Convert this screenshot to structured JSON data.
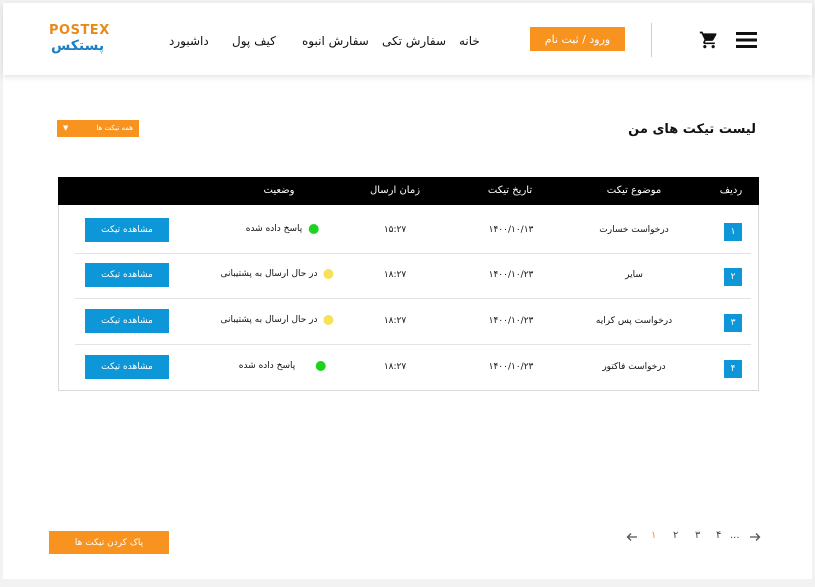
{
  "brand": {
    "logo_en": "POSTEX",
    "logo_fa": "پستکس",
    "accent": "#f7931e",
    "blue": "#0d96d8"
  },
  "nav": {
    "home": "خانه",
    "single_order": "سفارش تکی",
    "bulk_order": "سفارش انبوه",
    "wallet": "کیف پول",
    "dashboard": "داشبورد",
    "login": "ورود / ثبت نام",
    "cart_icon": "cart-icon",
    "menu_icon": "hamburger-menu-icon"
  },
  "page": {
    "title": "لیست تیکت های من"
  },
  "filter": {
    "selected": "همه تیکت ها",
    "icon": "chevron-down-icon"
  },
  "table": {
    "headers": {
      "index": "ردیف",
      "subject": "موضوع تیکت",
      "date": "تاریخ تیکت",
      "time": "زمان ارسال",
      "status": "وضعیت"
    },
    "rows": [
      {
        "index": "۱",
        "subject": "درخواست خسارت",
        "date": "۱۴۰۰/۱۰/۱۳",
        "time": "۱۵:۲۷",
        "status": "پاسخ داده شده",
        "status_color": "#1fd21f",
        "action": "مشاهده تیکت"
      },
      {
        "index": "۲",
        "subject": "سایر",
        "date": "۱۴۰۰/۱۰/۲۳",
        "time": "۱۸:۲۷",
        "status": "در حال ارسال به پشتیبانی",
        "status_color": "#f7e05a",
        "action": "مشاهده تیکت"
      },
      {
        "index": "۳",
        "subject": "درخواست پس کرایه",
        "date": "۱۴۰۰/۱۰/۲۳",
        "time": "۱۸:۲۷",
        "status": "در حال ارسال به پشتیبانی",
        "status_color": "#f7e05a",
        "action": "مشاهده تیکت"
      },
      {
        "index": "۴",
        "subject": "درخواست فاکتور",
        "date": "۱۴۰۰/۱۰/۲۳",
        "time": "۱۸:۲۷",
        "status": "پاسخ داده شده",
        "status_color": "#1fd21f",
        "action": "مشاهده تیکت"
      }
    ]
  },
  "footer": {
    "clear_button": "پاک کردن  تیکت ها",
    "pagination": {
      "pages": [
        "۱",
        "۲",
        "۳",
        "۴"
      ],
      "ellipsis": "...",
      "current": "۱"
    }
  }
}
